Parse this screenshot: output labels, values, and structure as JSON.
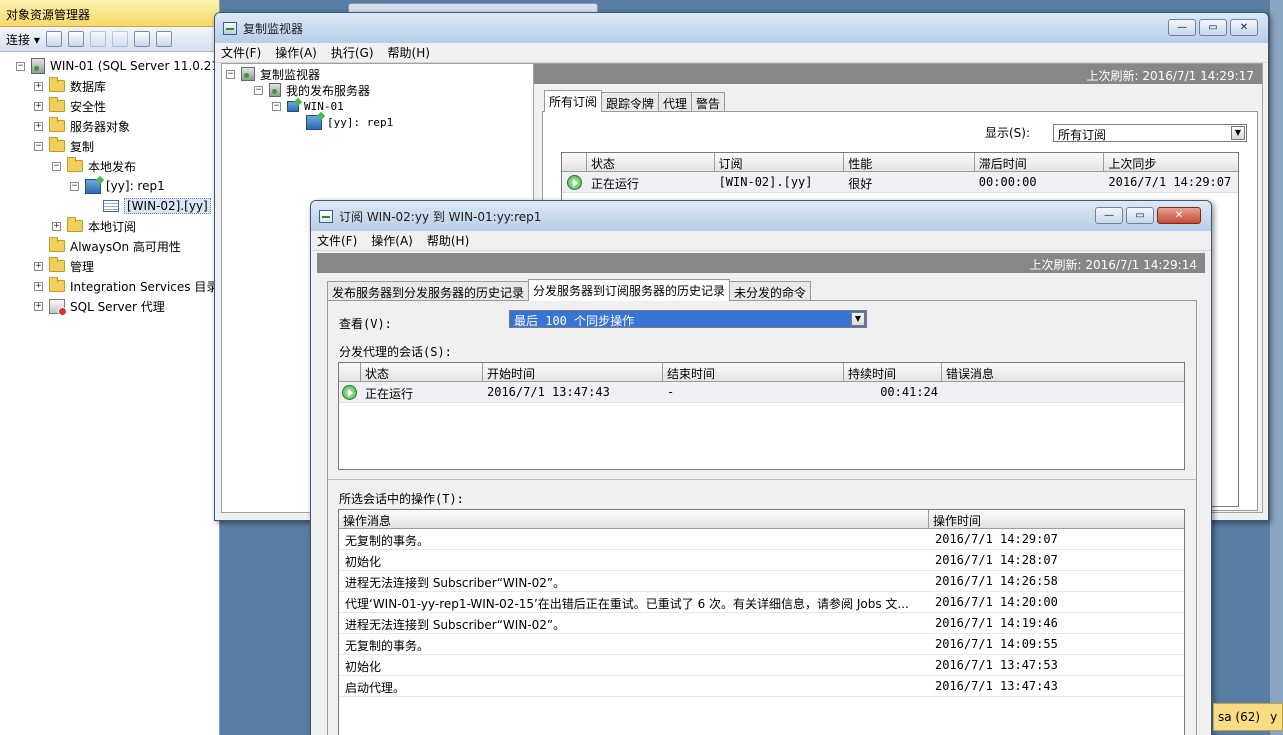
{
  "object_explorer": {
    "title": "对象资源管理器",
    "connect_label": "连接",
    "tree": [
      {
        "label": "WIN-01 (SQL Server 11.0.21",
        "level": 0,
        "expander": "−",
        "icon": "server-icon"
      },
      {
        "label": "数据库",
        "level": 1,
        "expander": "+",
        "icon": "folder-icon"
      },
      {
        "label": "安全性",
        "level": 1,
        "expander": "+",
        "icon": "folder-icon"
      },
      {
        "label": "服务器对象",
        "level": 1,
        "expander": "+",
        "icon": "folder-icon"
      },
      {
        "label": "复制",
        "level": 1,
        "expander": "−",
        "icon": "folder-icon"
      },
      {
        "label": "本地发布",
        "level": 2,
        "expander": "−",
        "icon": "folder-icon"
      },
      {
        "label": "[yy]: rep1",
        "level": 3,
        "expander": "−",
        "icon": "publication-icon"
      },
      {
        "label": "[WIN-02].[yy]",
        "level": 4,
        "expander": "",
        "icon": "subscription-icon",
        "selected": true
      },
      {
        "label": "本地订阅",
        "level": 2,
        "expander": "+",
        "icon": "folder-icon"
      },
      {
        "label": "AlwaysOn 高可用性",
        "level": 1,
        "expander": "",
        "icon": "folder-icon"
      },
      {
        "label": "管理",
        "level": 1,
        "expander": "+",
        "icon": "folder-icon"
      },
      {
        "label": "Integration Services 目录",
        "level": 1,
        "expander": "+",
        "icon": "folder-icon"
      },
      {
        "label": "SQL Server 代理",
        "level": 1,
        "expander": "+",
        "icon": "sql-agent-icon"
      }
    ]
  },
  "replication_monitor": {
    "title": "复制监视器",
    "menu": [
      "文件(F)",
      "操作(A)",
      "执行(G)",
      "帮助(H)"
    ],
    "tree": {
      "root": "复制监视器",
      "publishers": "我的发布服务器",
      "server": "WIN-01",
      "publication": "[yy]: rep1"
    },
    "last_refresh": "上次刷新: 2016/7/1 14:29:17",
    "tabs": [
      "所有订阅",
      "跟踪令牌",
      "代理",
      "警告"
    ],
    "show_label": "显示(S):",
    "show_value": "所有订阅",
    "grid": {
      "columns": [
        "",
        "状态",
        "订阅",
        "性能",
        "滞后时间",
        "上次同步"
      ],
      "rows": [
        {
          "status": "正在运行",
          "subscription": "[WIN-02].[yy]",
          "performance": "很好",
          "latency": "00:00:00",
          "last_sync": "2016/7/1 14:29:07"
        }
      ]
    }
  },
  "subscription_window": {
    "title": "订阅 WIN-02:yy 到 WIN-01:yy:rep1",
    "menu": [
      "文件(F)",
      "操作(A)",
      "帮助(H)"
    ],
    "last_refresh": "上次刷新: 2016/7/1 14:29:14",
    "tabs": [
      "发布服务器到分发服务器的历史记录",
      "分发服务器到订阅服务器的历史记录",
      "未分发的命令"
    ],
    "view_label": "查看(V):",
    "view_value": "最后 100 个同步操作",
    "sessions_label": "分发代理的会话(S):",
    "sessions": {
      "columns": [
        "",
        "状态",
        "开始时间",
        "结束时间",
        "持续时间",
        "错误消息"
      ],
      "rows": [
        {
          "status": "正在运行",
          "start": "2016/7/1 13:47:43",
          "end": "-",
          "duration": "00:41:24",
          "error": ""
        }
      ]
    },
    "ops_label": "所选会话中的操作(T):",
    "ops": {
      "columns": [
        "操作消息",
        "操作时间"
      ],
      "rows": [
        {
          "message": "无复制的事务。",
          "time": "2016/7/1 14:29:07"
        },
        {
          "message": "初始化",
          "time": "2016/7/1 14:28:07"
        },
        {
          "message": "进程无法连接到 Subscriber“WIN-02”。",
          "time": "2016/7/1 14:26:58"
        },
        {
          "message": "代理‘WIN-01-yy-rep1-WIN-02-15’在出错后正在重试。已重试了 6 次。有关详细信息，请参阅 Jobs 文...",
          "time": "2016/7/1 14:20:00"
        },
        {
          "message": "进程无法连接到 Subscriber“WIN-02”。",
          "time": "2016/7/1 14:19:46"
        },
        {
          "message": "无复制的事务。",
          "time": "2016/7/1 14:09:55"
        },
        {
          "message": "初始化",
          "time": "2016/7/1 13:47:53"
        },
        {
          "message": "启动代理。",
          "time": "2016/7/1 13:47:43"
        }
      ]
    }
  },
  "status": {
    "user": "sa (62)",
    "extra": "y"
  }
}
